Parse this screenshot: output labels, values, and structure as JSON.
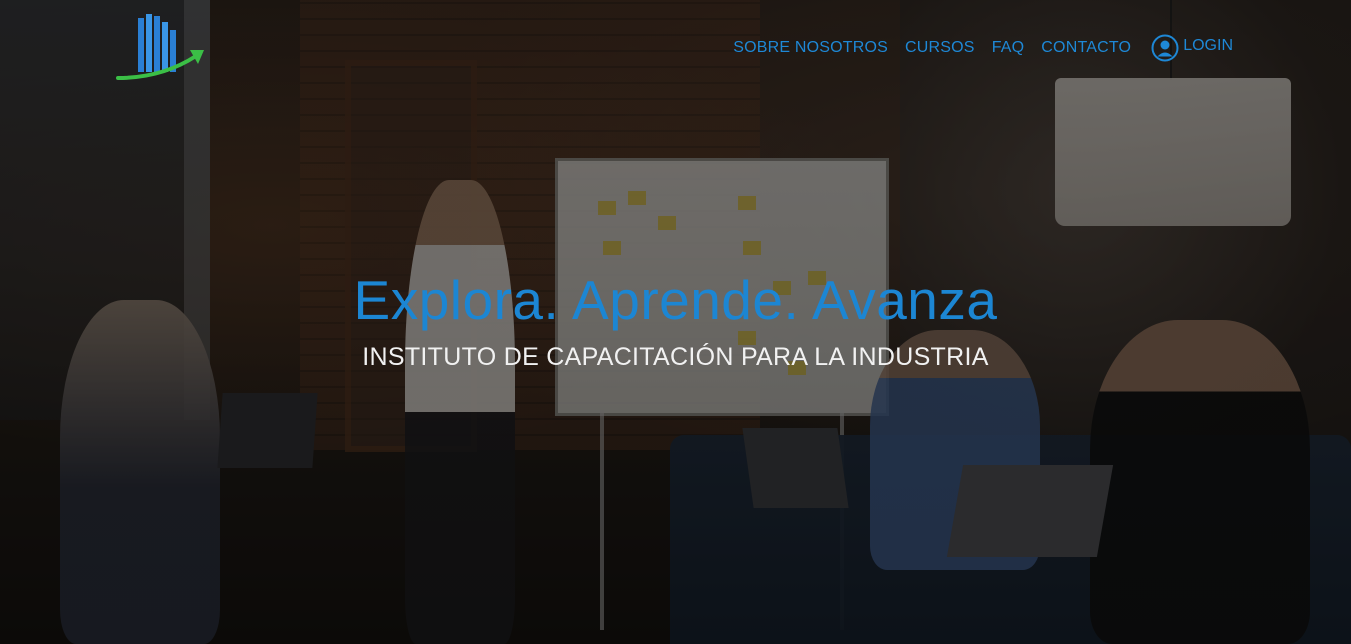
{
  "brand": {
    "logo_icon": "bar-chart-growth-logo",
    "colors": {
      "accent": "#1e88d6",
      "logo_blue": "#2a7fd4",
      "logo_green": "#3bbf46"
    }
  },
  "nav": {
    "items": [
      {
        "label": "SOBRE NOSOTROS"
      },
      {
        "label": "CURSOS"
      },
      {
        "label": "FAQ"
      },
      {
        "label": "CONTACTO"
      }
    ],
    "login": {
      "label": "LOGIN",
      "icon": "user-circle-icon"
    }
  },
  "hero": {
    "headline": "Explora. Aprende. Avanza",
    "subheadline": "INSTITUTO DE CAPACITACIÓN PARA LA INDUSTRIA",
    "background": "photo of team meeting in office with whiteboard"
  }
}
